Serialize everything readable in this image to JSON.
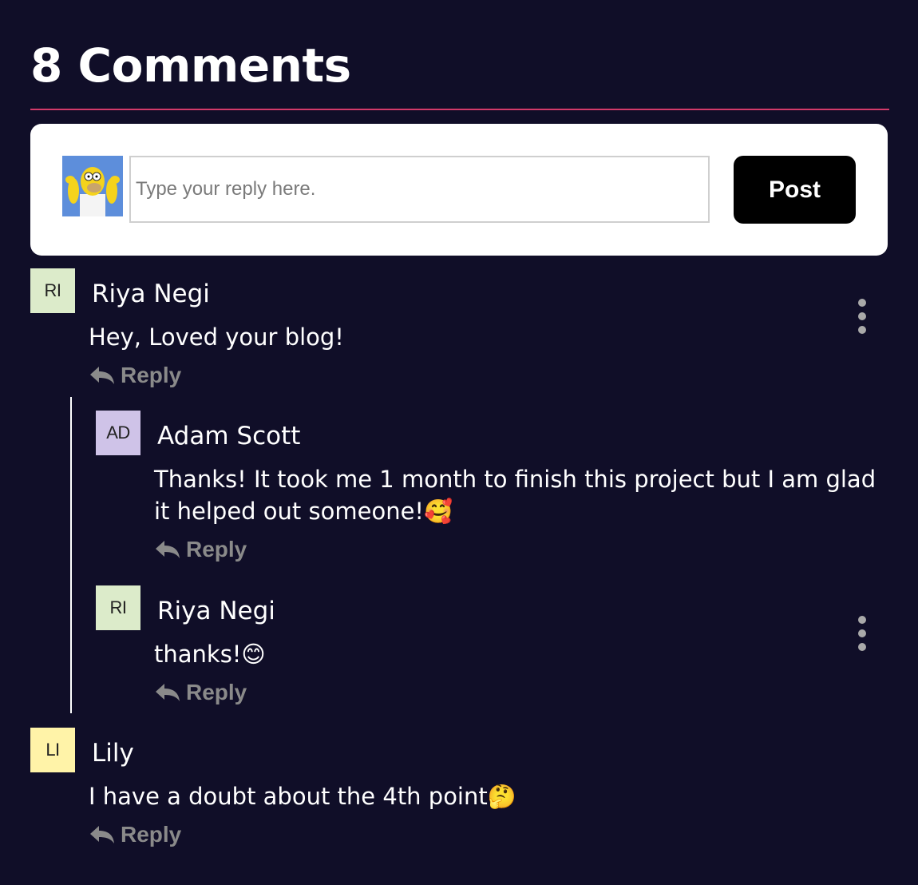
{
  "header": {
    "title": "8 Comments"
  },
  "reply_form": {
    "placeholder": "Type your reply here.",
    "post_label": "Post"
  },
  "colors": {
    "background": "#100e28",
    "accent_rule": "#d33a6a",
    "reply_gray": "#8a8a8a"
  },
  "comments": [
    {
      "initials": "RI",
      "avatar_color": "#dcebca",
      "author": "Riya Negi",
      "text": "Hey, Loved your blog!",
      "reply_label": "Reply",
      "replies": [
        {
          "initials": "AD",
          "avatar_color": "#cfc3e8",
          "author": "Adam Scott",
          "text": "Thanks! It took me 1 month to finish this project but I am glad it helped out someone!🥰",
          "reply_label": "Reply"
        },
        {
          "initials": "RI",
          "avatar_color": "#dcebca",
          "author": "Riya Negi",
          "text": "thanks!😊",
          "reply_label": "Reply"
        }
      ]
    },
    {
      "initials": "LI",
      "avatar_color": "#fff3a8",
      "author": "Lily",
      "text": "I have a doubt about the 4th point🤔",
      "reply_label": "Reply"
    }
  ],
  "icons": {
    "reply": "reply-arrow-icon",
    "menu": "vertical-dots-icon",
    "avatar": "user-avatar-image"
  }
}
